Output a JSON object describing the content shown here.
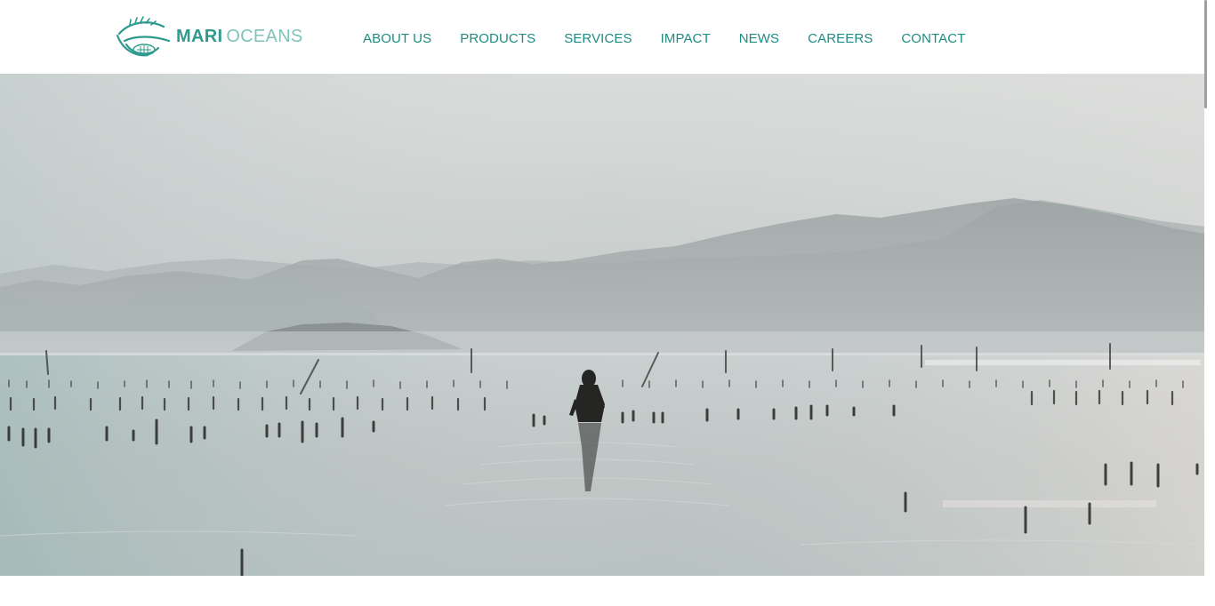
{
  "brand": {
    "name_primary": "MARI",
    "name_secondary": "OCEANS",
    "primary_color": "#2f9a8e",
    "secondary_color": "#7fc3b9"
  },
  "nav": {
    "items": [
      {
        "label": "ABOUT US"
      },
      {
        "label": "PRODUCTS"
      },
      {
        "label": "SERVICES"
      },
      {
        "label": "IMPACT"
      },
      {
        "label": "NEWS"
      },
      {
        "label": "CAREERS"
      },
      {
        "label": "CONTACT"
      }
    ]
  },
  "hero": {
    "image_icon": "seaweed-farm-photo"
  }
}
